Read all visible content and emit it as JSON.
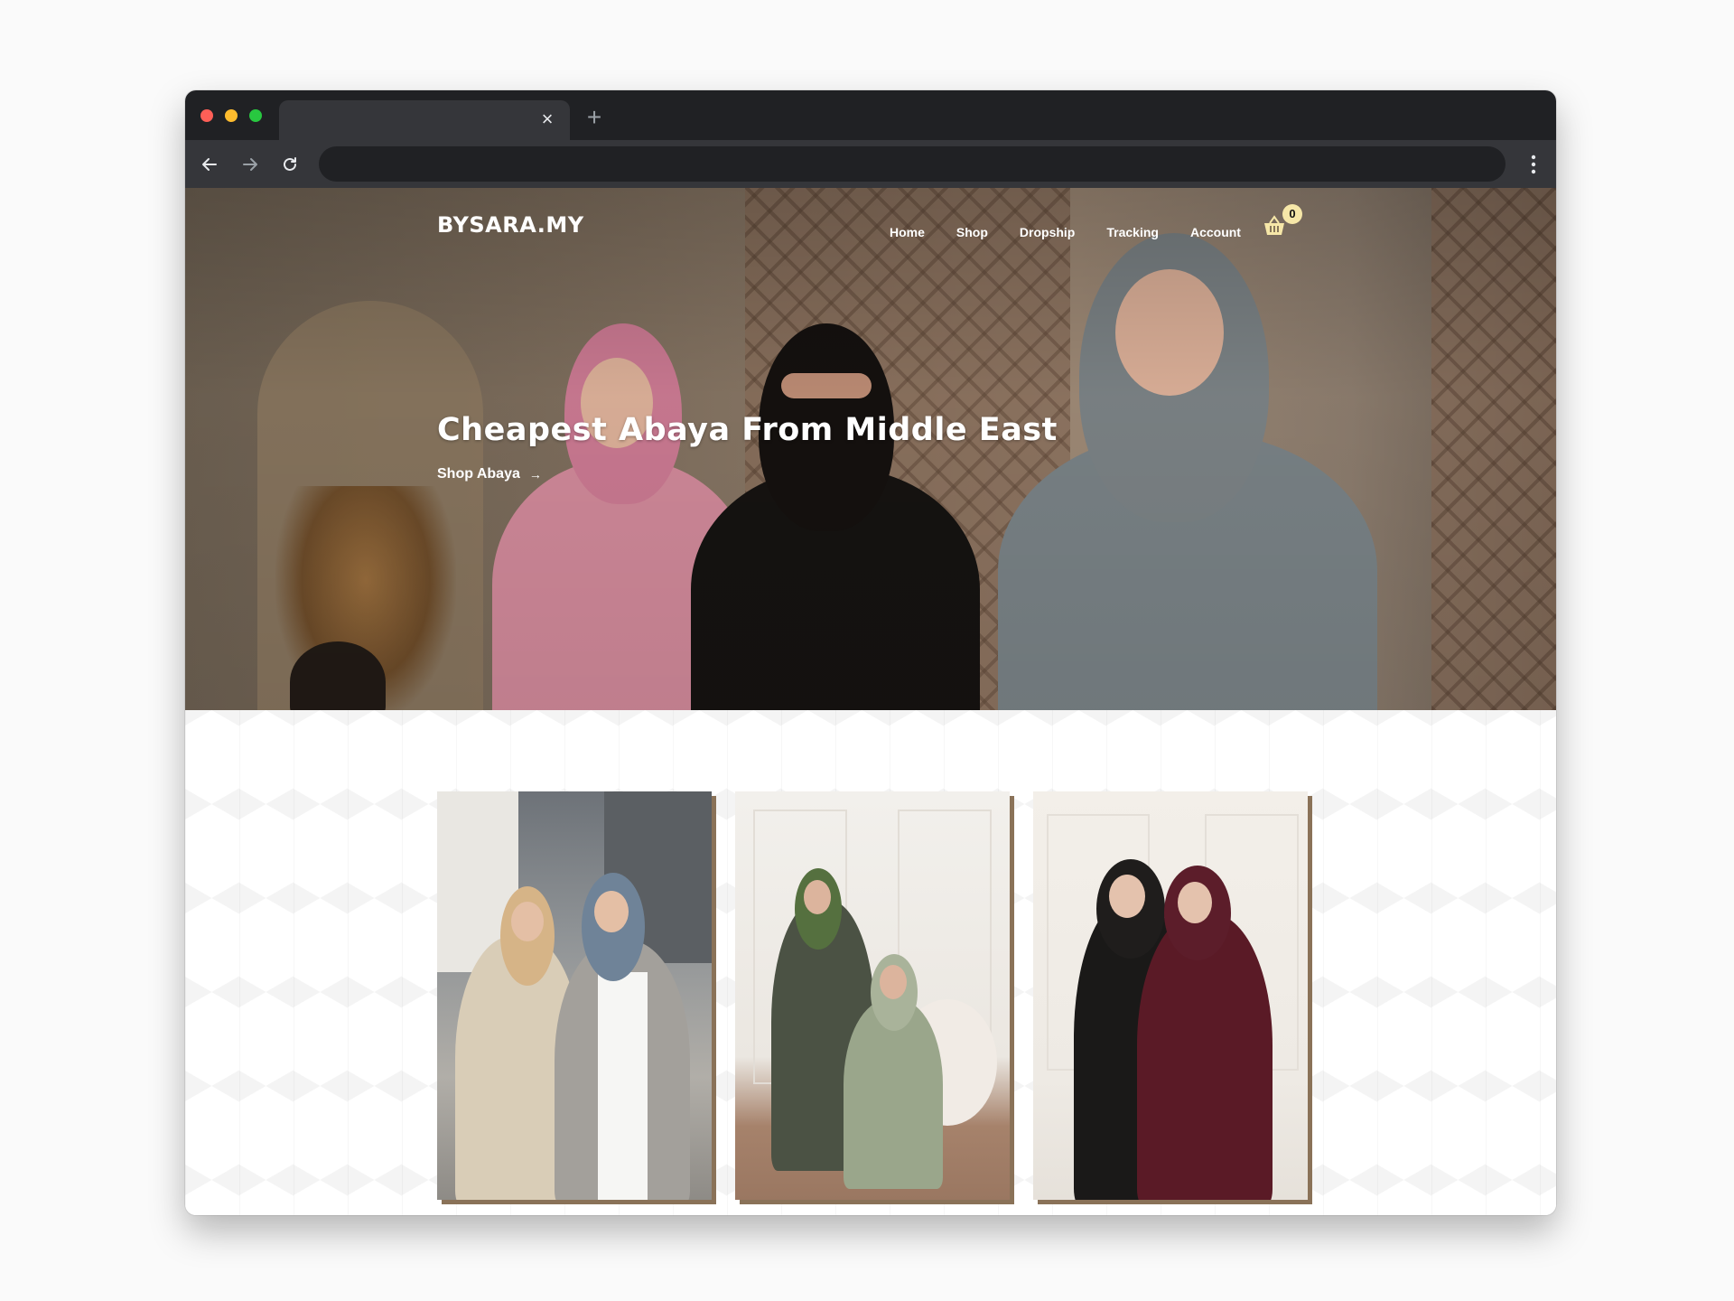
{
  "browser": {
    "tab_close_icon": "close-icon",
    "new_tab_icon": "plus-icon",
    "address_value": ""
  },
  "site": {
    "logo": "BYSARA.MY",
    "nav": [
      "Home",
      "Shop",
      "Dropship",
      "Tracking",
      "Account"
    ],
    "cart_count": "0"
  },
  "hero": {
    "title": "Cheapest Abaya From Middle East",
    "cta": "Shop Abaya",
    "cta_arrow": "→"
  },
  "colors": {
    "accent_shadow": "#8a7258",
    "badge": "#f6e7a8",
    "chrome_dark": "#202124",
    "chrome_mid": "#35363a"
  },
  "products": [
    {
      "image": "two women in beige and grey paisley kimono abayas"
    },
    {
      "image": "two women in olive green abaya sets"
    },
    {
      "image": "two women in black and maroon abayas"
    }
  ]
}
